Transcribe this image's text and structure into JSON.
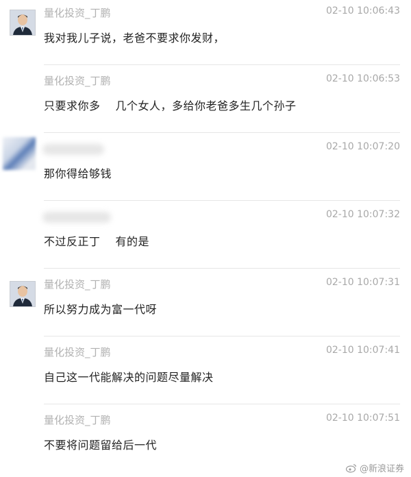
{
  "messages": [
    {
      "sender": "量化投资_丁鹏",
      "time": "02-10 10:06:43",
      "text": "我对我儿子说，老爸不要求你发财，",
      "avatar": "photo"
    },
    {
      "sender": "量化投资_丁鹏",
      "time": "02-10 10:06:53",
      "text_a": "只要求你多",
      "text_b": "几个女人，多给你老爸多生几个孙子",
      "avatar": "none"
    },
    {
      "sender": "",
      "time": "02-10 10:07:20",
      "text": "那你得给够钱",
      "avatar": "blurred"
    },
    {
      "sender": "",
      "time": "02-10 10:07:32",
      "text_a": "不过反正丁",
      "text_b": "有的是",
      "avatar": "none"
    },
    {
      "sender": "量化投资_丁鹏",
      "time": "02-10 10:07:31",
      "text": "所以努力成为富一代呀",
      "avatar": "photo"
    },
    {
      "sender": "量化投资_丁鹏",
      "time": "02-10 10:07:41",
      "text": "自己这一代能解决的问题尽量解决",
      "avatar": "none"
    },
    {
      "sender": "量化投资_丁鹏",
      "time": "02-10 10:07:51",
      "text": "不要将问题留给后一代",
      "avatar": "none"
    }
  ],
  "watermark": {
    "text": "@新浪证券",
    "icon": "weibo-icon"
  },
  "colors": {
    "sender": "#b1b1b1",
    "time": "#a8a8a8",
    "text": "#222222",
    "divider": "#e6e6e6"
  }
}
